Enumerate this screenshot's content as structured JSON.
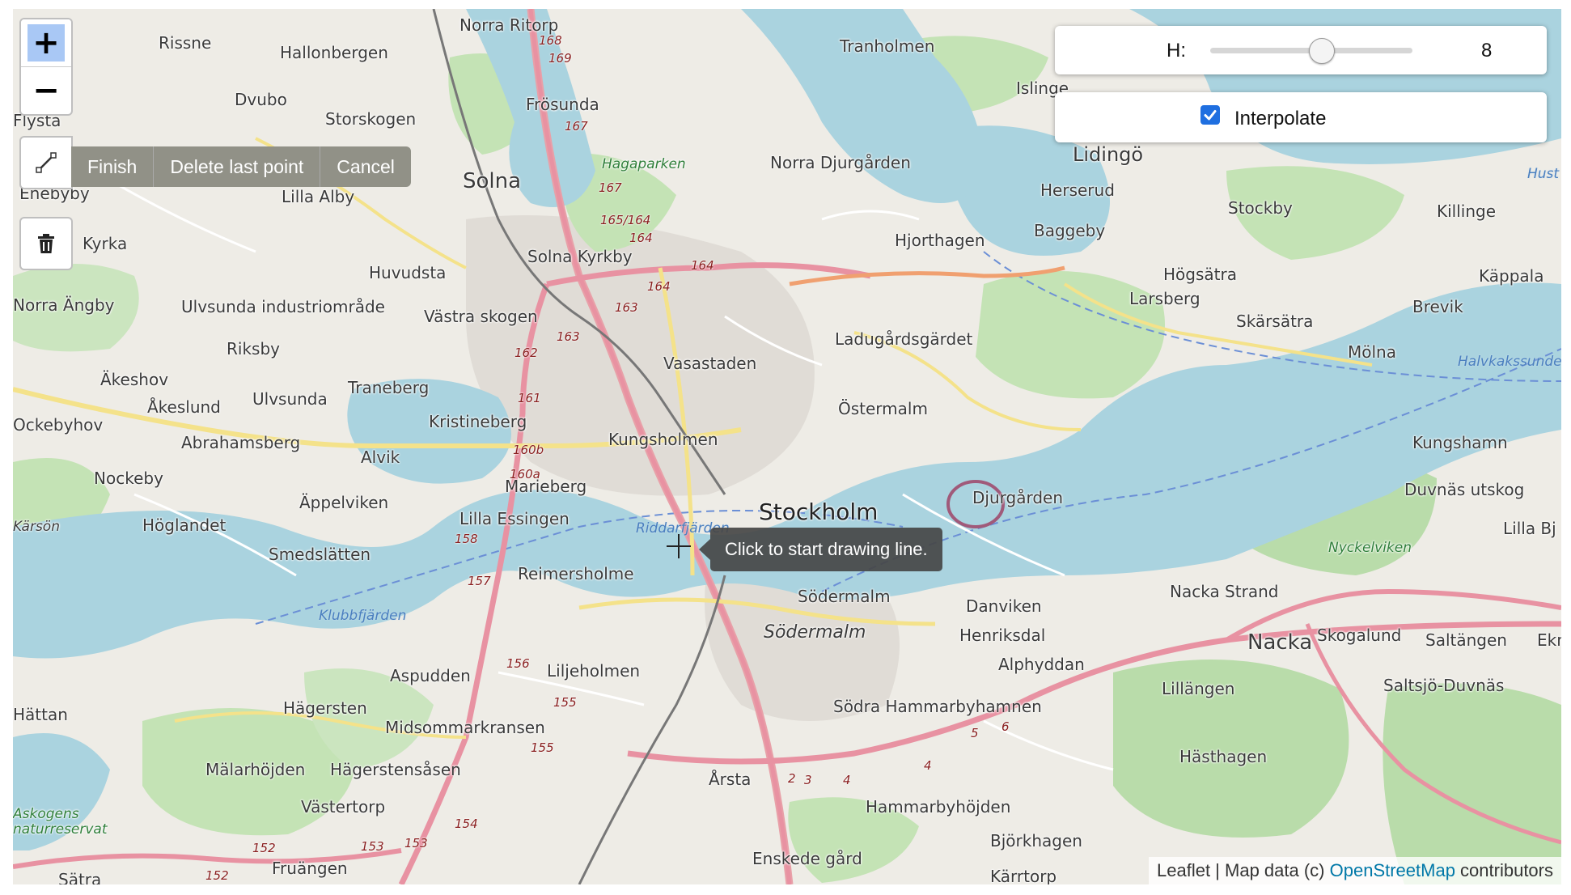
{
  "controls": {
    "zoom_in": "+",
    "zoom_out": "−",
    "draw_actions": [
      "Finish",
      "Delete last point",
      "Cancel"
    ],
    "draw_icon": "polyline-icon",
    "delete_icon": "trash-icon"
  },
  "height_control": {
    "label": "H:",
    "value": "8",
    "slider_fraction": 0.55
  },
  "interpolate": {
    "label": "Interpolate",
    "checked": true
  },
  "tooltip": "Click to start drawing line.",
  "attribution": {
    "prefix": "Leaflet | Map data (c) ",
    "link": "OpenStreetMap",
    "suffix": " contributors"
  },
  "map": {
    "major_labels": [
      "Stockholm"
    ],
    "place_labels": [
      "Rissne",
      "Hallonbergen",
      "Norra Ritorp",
      "Tranholmen",
      "Islinge",
      "Dvubo",
      "Frösunda",
      "Storskogen",
      "Flysta",
      "Solna",
      "Norra Djurgården",
      "Lidingö",
      "Herserud",
      "Stockby",
      "Killinge",
      "Enebyby",
      "Lilla Alby",
      "Baggeby",
      "Hjorthagen",
      "Kyrka",
      "Solna Kyrkby",
      "Huvudsta",
      "Högsätra",
      "Käppala",
      "Larsberg",
      "Brevik",
      "Norra Ängby",
      "Ulvsunda industriområde",
      "Västra skogen",
      "Skärsätra",
      "Ladugårdsgärdet",
      "Riksby",
      "Mölna",
      "Vasastaden",
      "Äkeshov",
      "Traneberg",
      "Åkeslund",
      "Ulvsunda",
      "Östermalm",
      "Ockebyhov",
      "Kristineberg",
      "Abrahamsberg",
      "Alvik",
      "Kungsholmen",
      "Kungshamn",
      "Nockeby",
      "Marieberg",
      "Djurgården",
      "Duvnäs utskog",
      "Äppelviken",
      "Kärsön",
      "Lilla Essingen",
      "Höglandet",
      "Lilla Bj",
      "Smedslätten",
      "Reimersholme",
      "Nacka Strand",
      "Södermalm",
      "Danviken",
      "Henriksdal",
      "Nacka",
      "Skogalund",
      "Saltängen",
      "Ekn",
      "Aspudden",
      "Alphyddan",
      "Liljeholmen",
      "Lillängen",
      "Saltsjö-Duvnäs",
      "Hägersten",
      "Hättan",
      "Midsommarkransen",
      "Södra Hammarbyhamnen",
      "Hästhagen",
      "Mälarhöjden",
      "Hägerstensåsen",
      "Årsta",
      "Västertorp",
      "Hammarbyhöjden",
      "Björkhagen",
      "Fruängen",
      "Enskede gård",
      "Kärrtorp",
      "Sätra"
    ],
    "italic_labels": [
      "Södermalm"
    ],
    "water_labels": [
      "Riddarfjärden",
      "Klubbfjärden",
      "Halvkakssundet",
      "Hust"
    ],
    "park_labels": [
      "Hagaparken",
      "Nyckelviken",
      "Askogens naturreservat"
    ],
    "road_shields": [
      "168",
      "169",
      "167",
      "167",
      "165/164",
      "164",
      "164",
      "164",
      "163",
      "163",
      "162",
      "161",
      "160b",
      "160a",
      "158",
      "157",
      "156",
      "155",
      "155",
      "154",
      "153",
      "153",
      "152",
      "152",
      "2",
      "3",
      "4",
      "4",
      "5",
      "6"
    ]
  }
}
